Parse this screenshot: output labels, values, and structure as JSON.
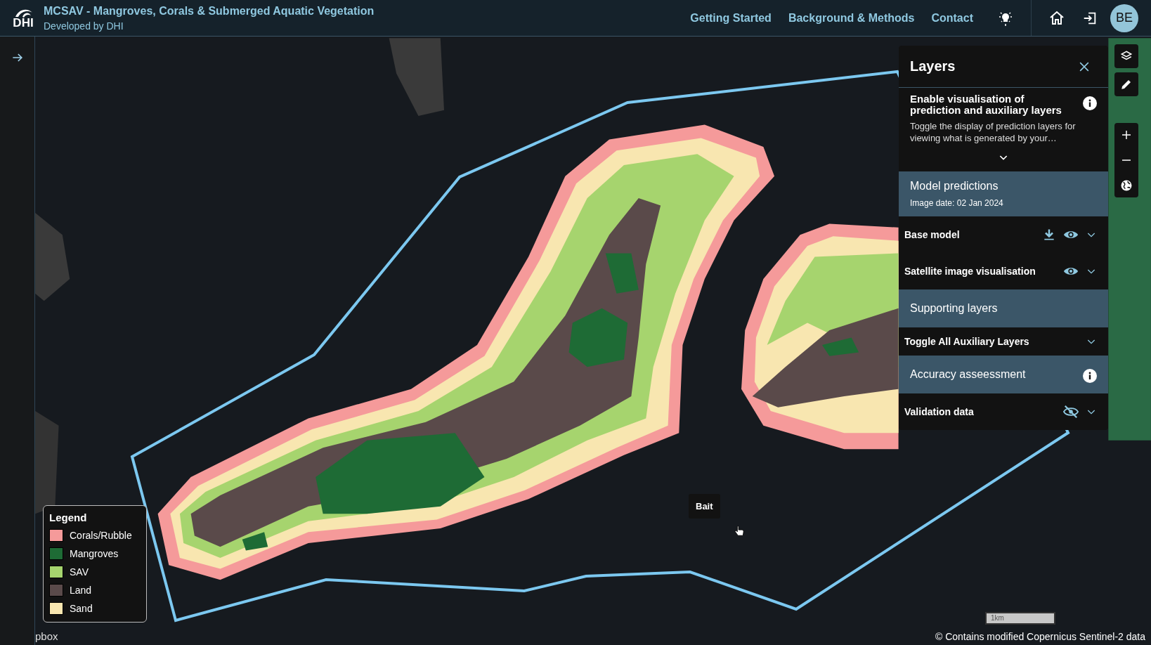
{
  "header": {
    "logo_text": "DHI",
    "title": "MCSAV - Mangroves, Corals & Submerged Aquatic Vegetation",
    "subtitle": "Developed by DHI",
    "nav": [
      "Getting Started",
      "Background & Methods",
      "Contact"
    ],
    "user_initials": "BE"
  },
  "layers_panel": {
    "title": "Layers",
    "intro_heading": "Enable visualisation of prediction and auxiliary layers",
    "intro_text": "Toggle the display of prediction layers for viewing what is generated by your…",
    "rows": [
      {
        "kind": "section",
        "title": "Model predictions",
        "subtitle": "Image date: 02 Jan 2024",
        "info": false
      },
      {
        "kind": "layer",
        "label": "Base model",
        "download": true,
        "visible": true
      },
      {
        "kind": "layer",
        "label": "Satellite image visualisation",
        "download": false,
        "visible": true
      },
      {
        "kind": "section",
        "title": "Supporting layers",
        "info": false
      },
      {
        "kind": "toggle",
        "label": "Toggle All Auxiliary Layers"
      },
      {
        "kind": "section",
        "title": "Accuracy asseessment",
        "info": true
      },
      {
        "kind": "layer",
        "label": "Validation data",
        "download": false,
        "visible": false
      }
    ]
  },
  "legend": {
    "title": "Legend",
    "items": [
      {
        "label": "Corals/Rubble",
        "color": "#f59a9a"
      },
      {
        "label": "Mangroves",
        "color": "#1e6b35"
      },
      {
        "label": "SAV",
        "color": "#a6d46e"
      },
      {
        "label": "Land",
        "color": "#5a4a4a"
      },
      {
        "label": "Sand",
        "color": "#f8e6b0"
      }
    ]
  },
  "map": {
    "tooltip": "Bait",
    "scale_label": "1km",
    "attribution": "© Contains modified Copernicus Sentinel-2 data",
    "cut_credit": "pbox"
  }
}
